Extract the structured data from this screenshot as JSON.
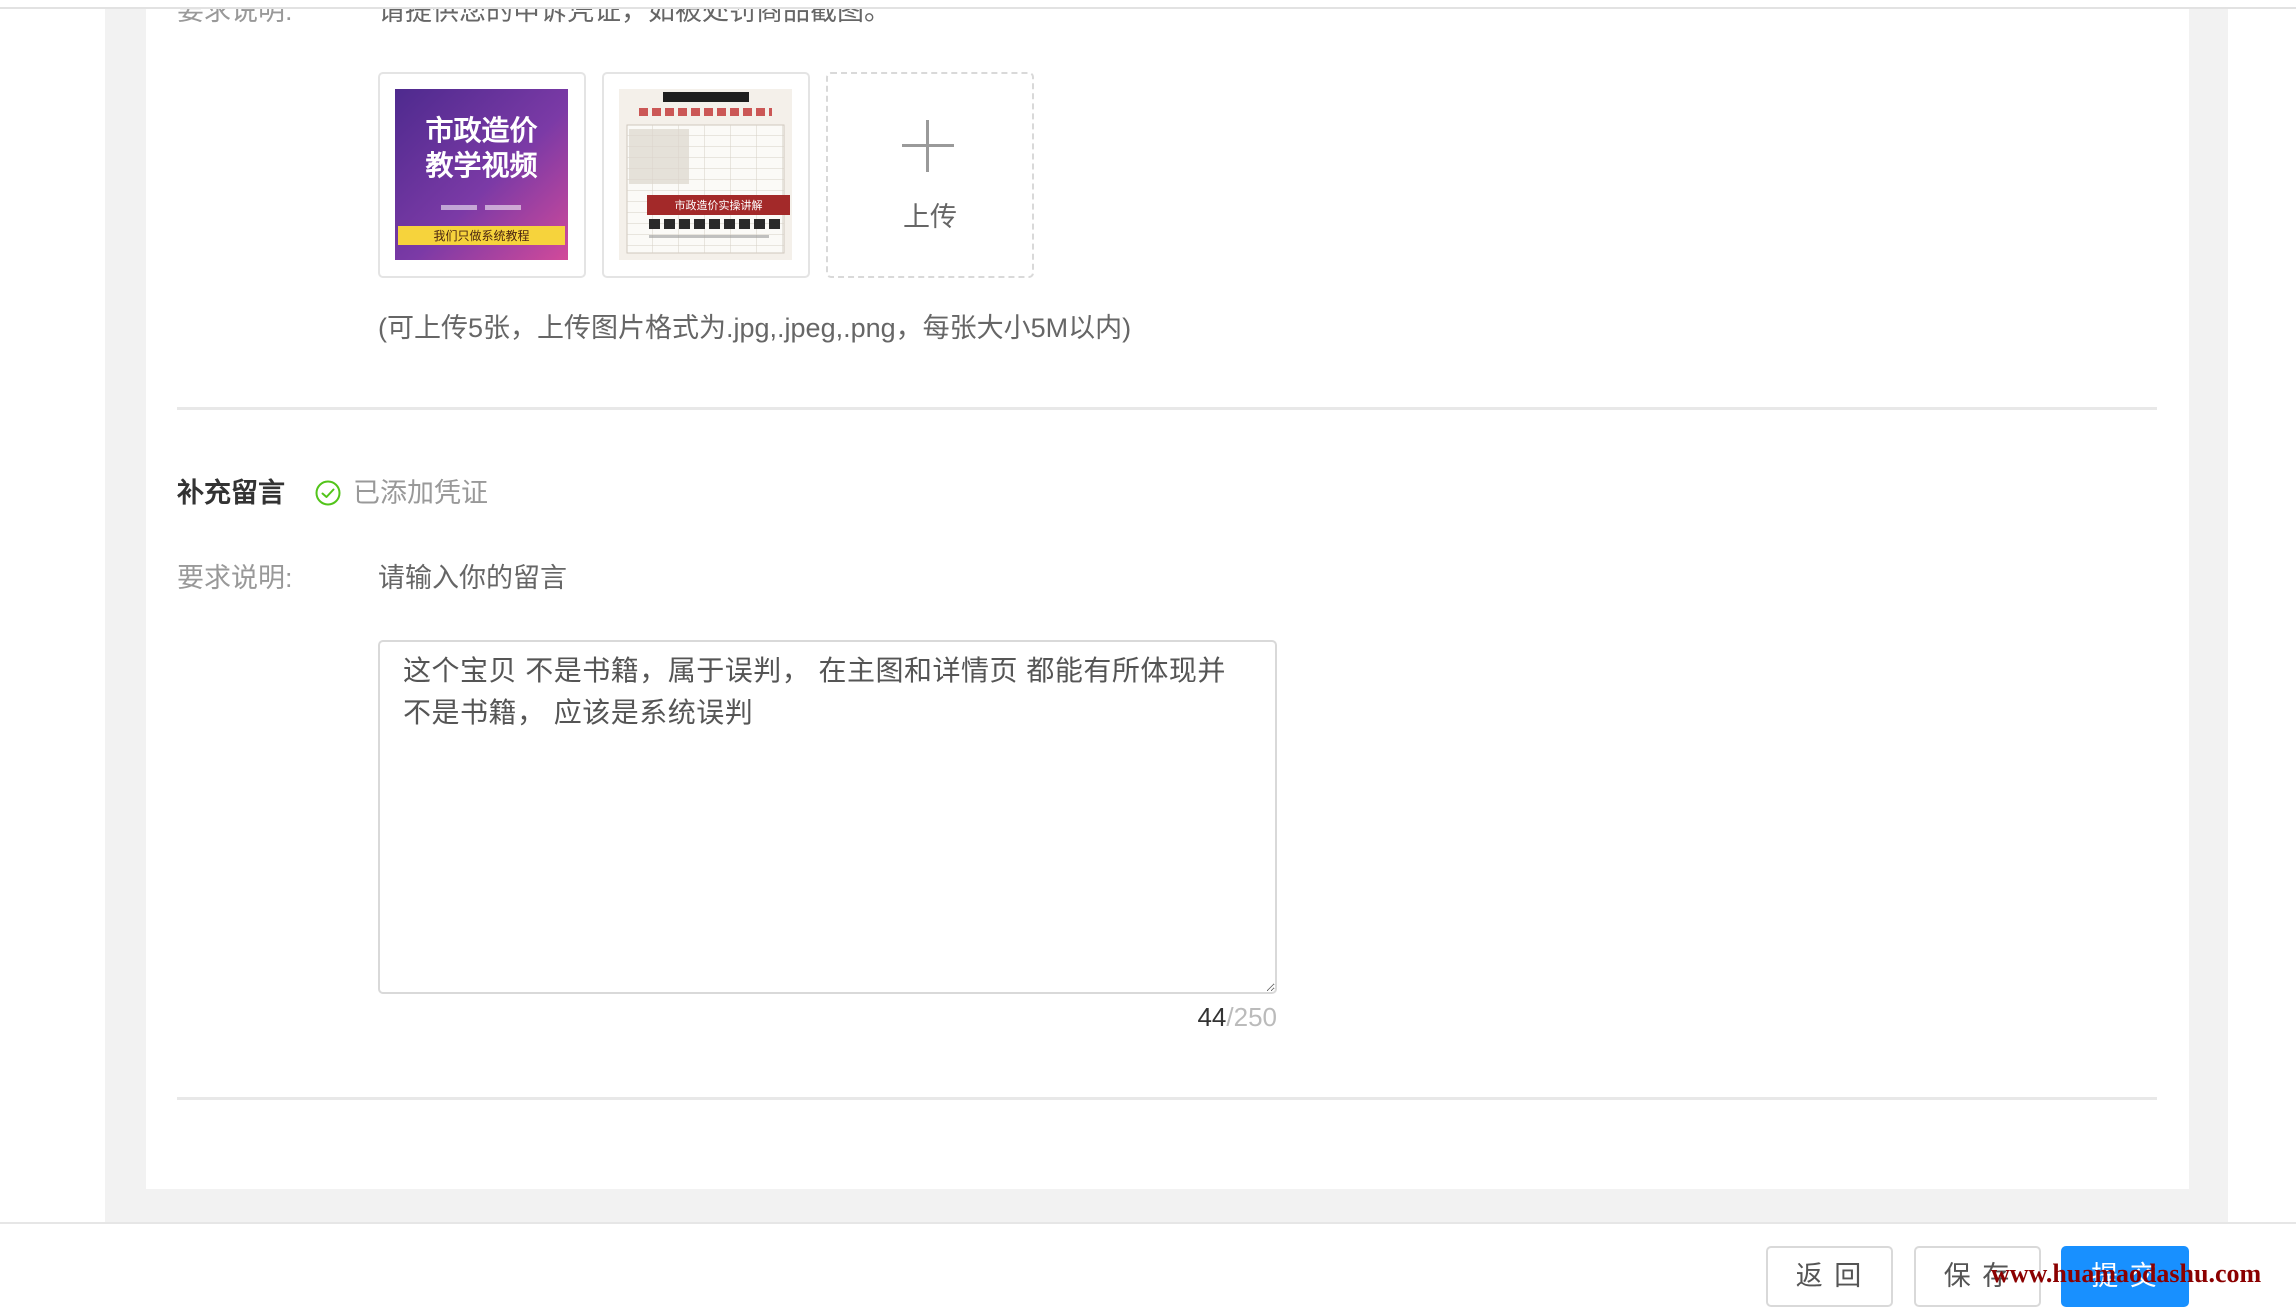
{
  "colors": {
    "accent": "#1890ff",
    "success": "#52c41a",
    "watermark": "#8b0000",
    "page_bg": "#f2f2f2"
  },
  "evidence": {
    "label": "要求说明:",
    "description": "请提供您的申诉凭证，如被处罚商品截图。",
    "images": [
      {
        "title_line1": "市政造价",
        "title_line2": "教学视频",
        "band_text": "我们只做系统教程"
      },
      {
        "band_text": "市政造价实操讲解"
      }
    ],
    "upload": {
      "label": "上传",
      "icon": "plus-icon"
    },
    "hint": "(可上传5张，上传图片格式为.jpg,.jpeg,.png，每张大小5M以内)"
  },
  "message": {
    "title": "补充留言",
    "status_icon": "check-circle-icon",
    "status": "已添加凭证",
    "label": "要求说明:",
    "prompt": "请输入你的留言",
    "value": "这个宝贝 不是书籍，属于误判， 在主图和详情页 都能有所体现并不是书籍， 应该是系统误判",
    "count": "44",
    "limit": "/250"
  },
  "footer": {
    "back_label": "返 回",
    "save_label": "保 存",
    "submit_label": "提 交"
  },
  "watermark": "www.huamaodashu.com"
}
